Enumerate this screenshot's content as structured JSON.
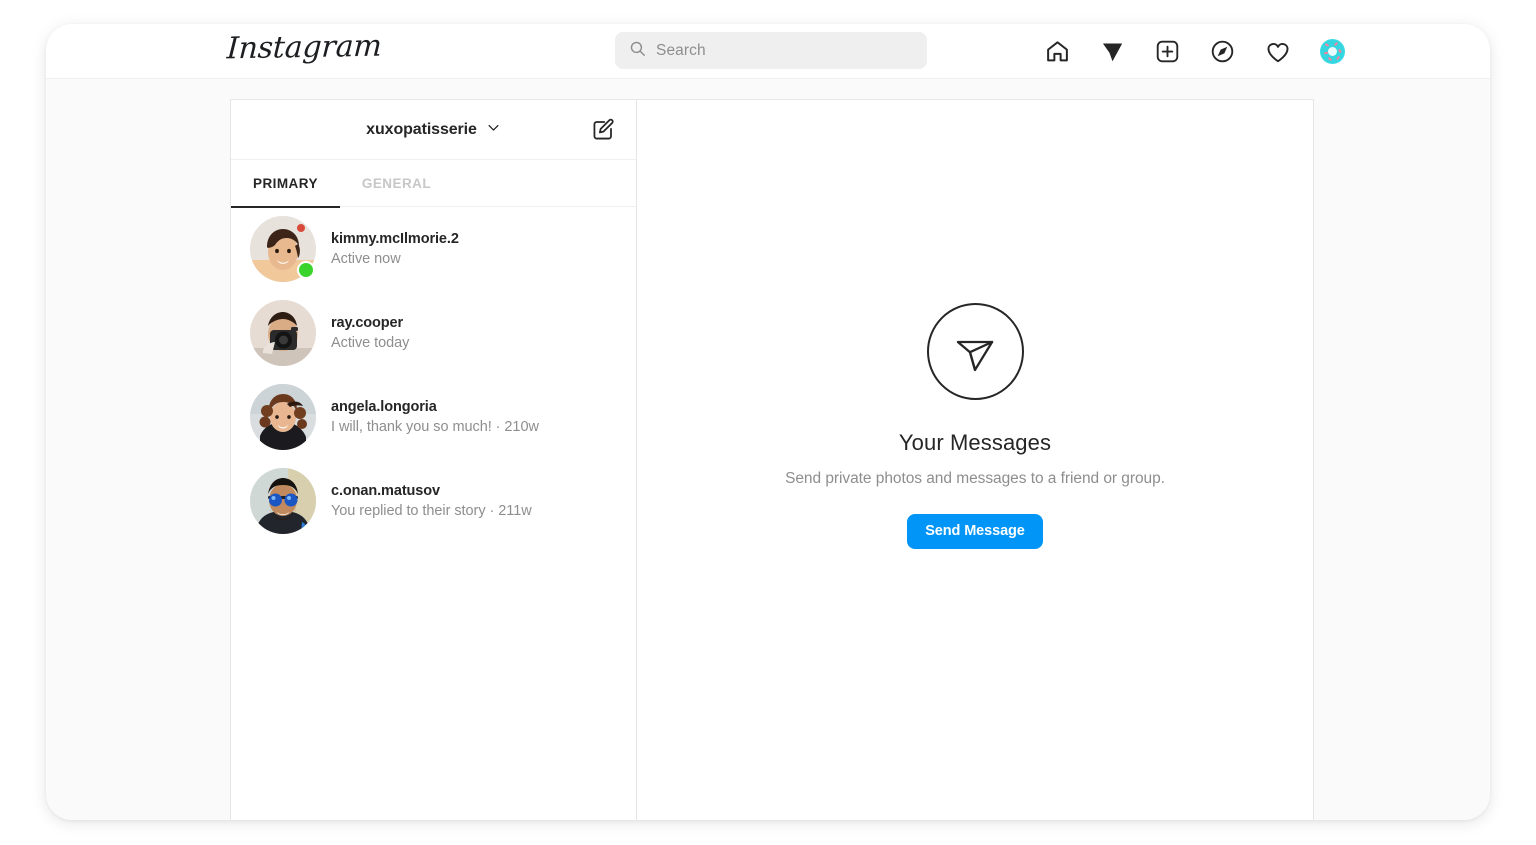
{
  "app": {
    "brand": "Instagram"
  },
  "search": {
    "placeholder": "Search",
    "value": "",
    "icon": "search-icon"
  },
  "nav": {
    "items": [
      {
        "name": "home-icon",
        "label": "Home",
        "active": false
      },
      {
        "name": "direct-messages-icon",
        "label": "Messages",
        "active": true
      },
      {
        "name": "new-post-icon",
        "label": "New Post",
        "active": false
      },
      {
        "name": "explore-icon",
        "label": "Explore",
        "active": false
      },
      {
        "name": "activity-heart-icon",
        "label": "Activity",
        "active": false
      },
      {
        "name": "profile-avatar",
        "label": "Profile",
        "active": false
      }
    ]
  },
  "inbox": {
    "account_name": "xuxopatisserie",
    "chevron": "chevron-down-icon",
    "compose_icon": "compose-message-icon",
    "tabs": [
      {
        "label": "PRIMARY",
        "active": true
      },
      {
        "label": "GENERAL",
        "active": false
      }
    ],
    "conversations": [
      {
        "username": "kimmy.mcIlmorie.2",
        "snippet": "Active now",
        "online": true,
        "avatar": "woman-short-brown-hair-photo"
      },
      {
        "username": "ray.cooper",
        "snippet": "Active today",
        "online": false,
        "avatar": "person-holding-camera-photo"
      },
      {
        "username": "angela.longoria",
        "snippet": "I will, thank you so much!  · 210w",
        "online": false,
        "avatar": "woman-curly-hair-photo"
      },
      {
        "username": "c.onan.matusov",
        "snippet": "You replied to their story · 211w",
        "online": false,
        "avatar": "man-blue-sunglasses-photo"
      }
    ]
  },
  "empty_state": {
    "icon": "paper-plane-circle-icon",
    "title": "Your Messages",
    "description": "Send private photos and messages to a friend or group.",
    "button_label": "Send Message"
  },
  "colors": {
    "accent_blue": "#0095f6",
    "online_green": "#3ad32b",
    "text_primary": "#262626",
    "text_secondary": "#8e8e8e",
    "page_bg": "#fafafa",
    "border": "#e6e6e6"
  }
}
